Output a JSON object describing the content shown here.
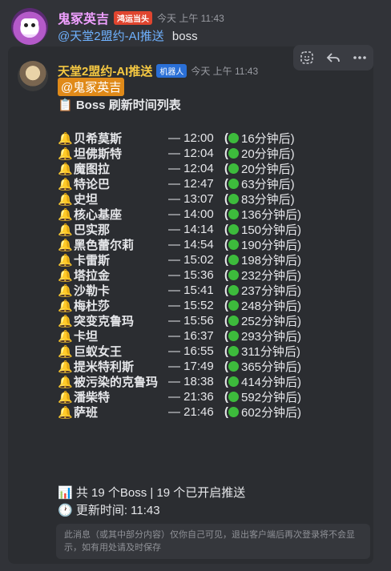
{
  "message1": {
    "username": "鬼冢英吉",
    "badge": "鸿运当头",
    "time": "今天 上午 11:43",
    "mention": "@天堂2盟约-AI推送",
    "text": "boss"
  },
  "message2": {
    "username": "天堂2盟约-AI推送",
    "badge": "机器人",
    "time": "今天 上午 11:43",
    "mention": "@鬼冢英吉",
    "title": "📋 Boss 刷新时间列表",
    "bosses": [
      {
        "name": "贝希莫斯",
        "time": "— 12:00",
        "eta": "16分钟后)"
      },
      {
        "name": "坦佛斯特",
        "time": "— 12:04",
        "eta": "20分钟后)"
      },
      {
        "name": "魔图拉",
        "time": "— 12:04",
        "eta": "20分钟后)"
      },
      {
        "name": "特论巴",
        "time": "— 12:47",
        "eta": "63分钟后)"
      },
      {
        "name": "史坦",
        "time": "— 13:07",
        "eta": "83分钟后)"
      },
      {
        "name": "核心基座",
        "time": "— 14:00",
        "eta": "136分钟后)"
      },
      {
        "name": "巴实那",
        "time": "— 14:14",
        "eta": "150分钟后)"
      },
      {
        "name": "黑色蕾尔莉",
        "time": "— 14:54",
        "eta": "190分钟后)"
      },
      {
        "name": "卡雷斯",
        "time": "— 15:02",
        "eta": "198分钟后)"
      },
      {
        "name": "塔拉金",
        "time": "— 15:36",
        "eta": "232分钟后)"
      },
      {
        "name": "沙勒卡",
        "time": "— 15:41",
        "eta": "237分钟后)"
      },
      {
        "name": "梅杜莎",
        "time": "— 15:52",
        "eta": "248分钟后)"
      },
      {
        "name": "突变克鲁玛",
        "time": "— 15:56",
        "eta": "252分钟后)"
      },
      {
        "name": "卡坦",
        "time": "— 16:37",
        "eta": "293分钟后)"
      },
      {
        "name": "巨蚁女王",
        "time": "— 16:55",
        "eta": "311分钟后)"
      },
      {
        "name": "提米特利斯",
        "time": "— 17:49",
        "eta": "365分钟后)"
      },
      {
        "name": "被污染的克鲁玛",
        "time": "— 18:38",
        "eta": "414分钟后)"
      },
      {
        "name": "潘柴特",
        "time": "— 21:36",
        "eta": "592分钟后)"
      },
      {
        "name": "萨班",
        "time": "— 21:46",
        "eta": "602分钟后)"
      }
    ],
    "bell_icon": "🔔",
    "summary": "📊 共 19 个Boss | 19 个已开启推送",
    "updated": "🕐 更新时间: 11:43",
    "notice": "此消息（或其中部分内容）仅你自己可见，退出客户端后再次登录将不会显示，如有用处请及时保存"
  },
  "toolbar": {
    "icons": [
      "add-reaction-icon",
      "reply-icon",
      "more-icon"
    ]
  },
  "colors": {
    "background": "#313338",
    "card": "#2b2d31",
    "bot_name": "#f5c842",
    "mention_pill": "#e08a19",
    "status_dot": "#3dbb3c"
  }
}
